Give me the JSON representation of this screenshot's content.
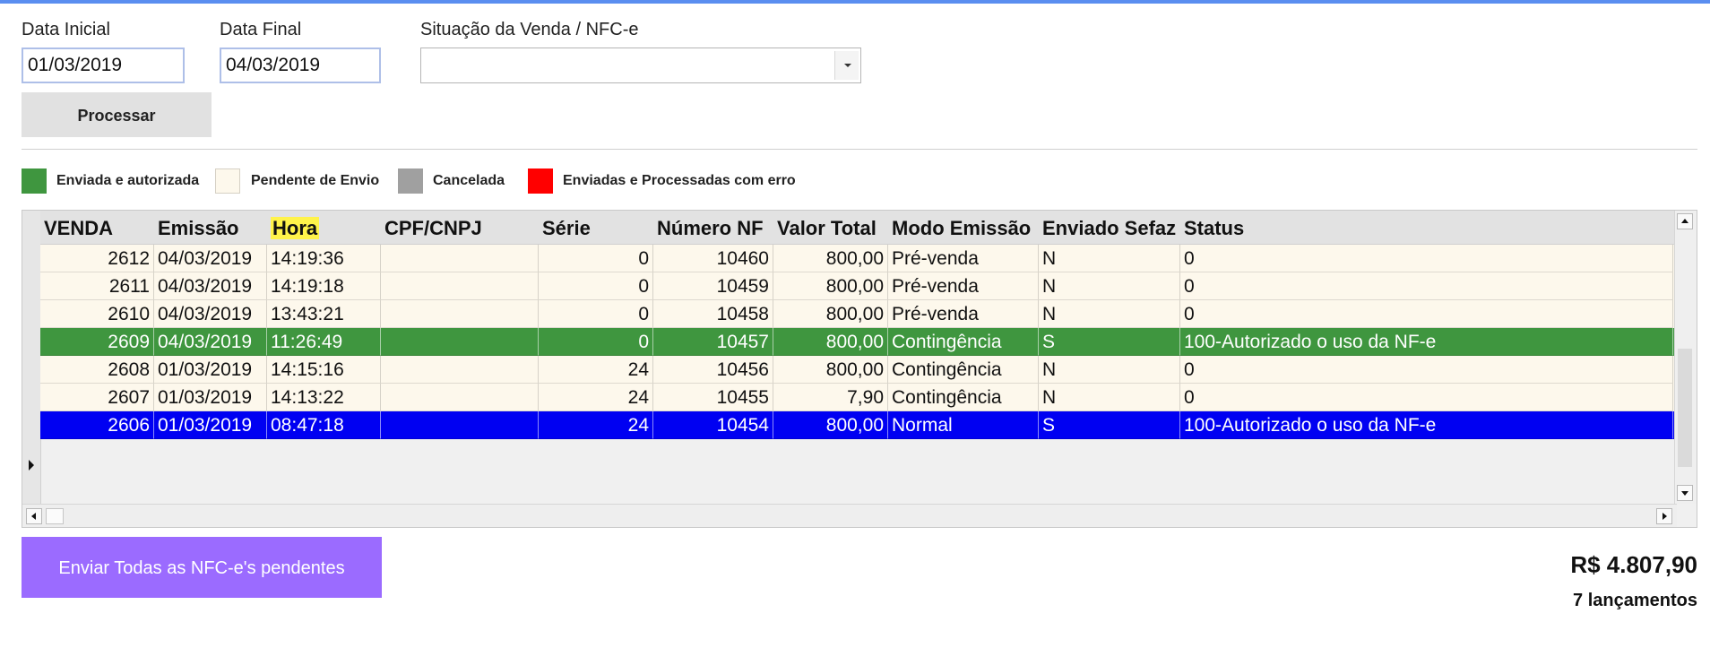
{
  "filters": {
    "start_label": "Data Inicial",
    "start_value": "01/03/2019",
    "end_label": "Data Final",
    "end_value": "04/03/2019",
    "status_label": "Situação da Venda / NFC-e",
    "status_value": "",
    "process_button": "Processar"
  },
  "legend": [
    {
      "label": "Enviada e autorizada",
      "color": "#3f963f"
    },
    {
      "label": "Pendente de Envio",
      "color": "#fdf8ec"
    },
    {
      "label": "Cancelada",
      "color": "#a0a0a0"
    },
    {
      "label": "Enviadas e Processadas com erro",
      "color": "#ff0000"
    }
  ],
  "table": {
    "columns": [
      "VENDA",
      "Emissão",
      "Hora",
      "CPF/CNPJ",
      "Série",
      "Número NF",
      "Valor Total",
      "Modo Emissão",
      "Enviado Sefaz",
      "Status"
    ],
    "rows": [
      {
        "venda": "2612",
        "emissao": "04/03/2019",
        "hora": "14:19:36",
        "cpf": "",
        "serie": "0",
        "numero": "10460",
        "valor": "800,00",
        "modo": "Pré-venda",
        "enviado": "N",
        "status": "0",
        "state": "pend"
      },
      {
        "venda": "2611",
        "emissao": "04/03/2019",
        "hora": "14:19:18",
        "cpf": "",
        "serie": "0",
        "numero": "10459",
        "valor": "800,00",
        "modo": "Pré-venda",
        "enviado": "N",
        "status": "0",
        "state": "pend"
      },
      {
        "venda": "2610",
        "emissao": "04/03/2019",
        "hora": "13:43:21",
        "cpf": "",
        "serie": "0",
        "numero": "10458",
        "valor": "800,00",
        "modo": "Pré-venda",
        "enviado": "N",
        "status": "0",
        "state": "pend"
      },
      {
        "venda": "2609",
        "emissao": "04/03/2019",
        "hora": "11:26:49",
        "cpf": "",
        "serie": "0",
        "numero": "10457",
        "valor": "800,00",
        "modo": "Contingência",
        "enviado": "S",
        "status": "100-Autorizado o uso da NF-e",
        "state": "auth"
      },
      {
        "venda": "2608",
        "emissao": "01/03/2019",
        "hora": "14:15:16",
        "cpf": "",
        "serie": "24",
        "numero": "10456",
        "valor": "800,00",
        "modo": "Contingência",
        "enviado": "N",
        "status": "0",
        "state": "pend"
      },
      {
        "venda": "2607",
        "emissao": "01/03/2019",
        "hora": "14:13:22",
        "cpf": "",
        "serie": "24",
        "numero": "10455",
        "valor": "7,90",
        "modo": "Contingência",
        "enviado": "N",
        "status": "0",
        "state": "pend"
      },
      {
        "venda": "2606",
        "emissao": "01/03/2019",
        "hora": "08:47:18",
        "cpf": "",
        "serie": "24",
        "numero": "10454",
        "valor": "800,00",
        "modo": "Normal",
        "enviado": "S",
        "status": "100-Autorizado o uso da NF-e",
        "state": "sel"
      }
    ]
  },
  "footer": {
    "send_button": "Enviar Todas as NFC-e's pendentes",
    "total": "R$ 4.807,90",
    "count": "7 lançamentos"
  }
}
